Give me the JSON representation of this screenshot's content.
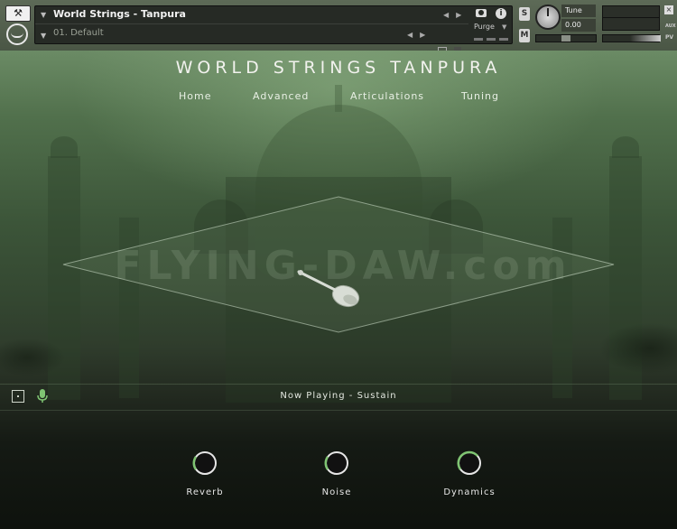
{
  "header": {
    "instrument_name": "World Strings - Tanpura",
    "preset_name": "01. Default",
    "purge_label": "Purge",
    "solo_label": "S",
    "mute_label": "M",
    "tune_label": "Tune",
    "tune_value": "0.00",
    "aux_label": "AUX",
    "pv_label": "PV",
    "close_label": "×",
    "wrench_icon": "wrench-icon"
  },
  "panel": {
    "title": "WORLD STRINGS TANPURA",
    "nav": [
      "Home",
      "Advanced",
      "Articulations",
      "Tuning"
    ],
    "watermark": "FLYING-DAW.com",
    "now_playing": "Now Playing - Sustain",
    "knobs": [
      {
        "label": "Reverb",
        "level": 0.0
      },
      {
        "label": "Noise",
        "level": 0.0
      },
      {
        "label": "Dynamics",
        "level": 0.3
      }
    ]
  },
  "colors": {
    "accent": "#7fc472",
    "panel_top": "#6b8b65",
    "panel_bottom": "#0e120d"
  }
}
